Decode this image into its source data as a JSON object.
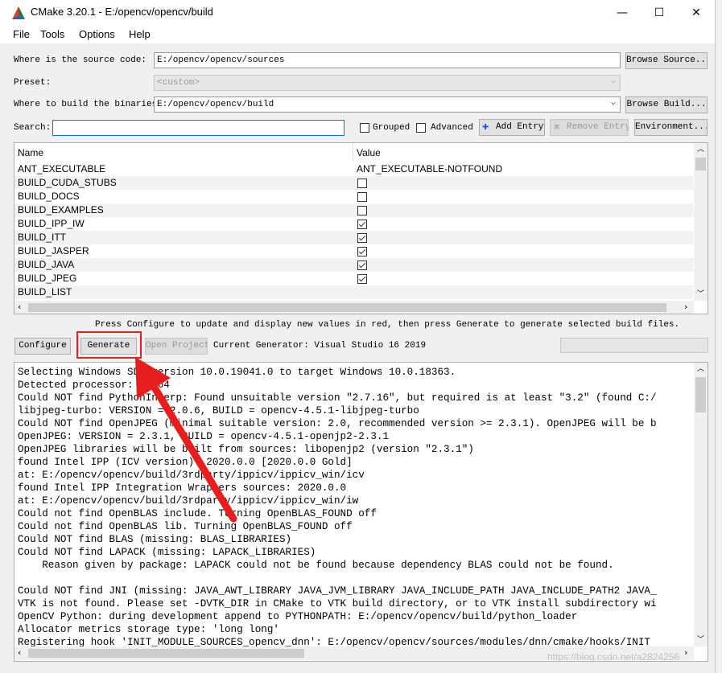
{
  "window": {
    "title": "CMake 3.20.1 - E:/opencv/opencv/build",
    "minimize": "—",
    "maximize": "☐",
    "close": "✕"
  },
  "menu": [
    "File",
    "Tools",
    "Options",
    "Help"
  ],
  "form": {
    "source_label": "Where is the source code:",
    "source_value": "E:/opencv/opencv/sources",
    "browse_source": "Browse Source...",
    "preset_label": "Preset:",
    "preset_value": "<custom>",
    "build_label": "Where to build the binaries:",
    "build_value": "E:/opencv/opencv/build",
    "browse_build": "Browse Build...",
    "search_label": "Search:",
    "search_value": "",
    "grouped": "Grouped",
    "advanced": "Advanced",
    "add_entry": "Add Entry",
    "remove_entry": "Remove Entry",
    "environment": "Environment..."
  },
  "table": {
    "headers": [
      "Name",
      "Value"
    ],
    "rows": [
      {
        "name": "ANT_EXECUTABLE",
        "value": "ANT_EXECUTABLE-NOTFOUND",
        "kind": "text"
      },
      {
        "name": "BUILD_CUDA_STUBS",
        "value": "",
        "kind": "check",
        "checked": false
      },
      {
        "name": "BUILD_DOCS",
        "value": "",
        "kind": "check",
        "checked": false
      },
      {
        "name": "BUILD_EXAMPLES",
        "value": "",
        "kind": "check",
        "checked": false
      },
      {
        "name": "BUILD_IPP_IW",
        "value": "",
        "kind": "check",
        "checked": true
      },
      {
        "name": "BUILD_ITT",
        "value": "",
        "kind": "check",
        "checked": true
      },
      {
        "name": "BUILD_JASPER",
        "value": "",
        "kind": "check",
        "checked": true
      },
      {
        "name": "BUILD_JAVA",
        "value": "",
        "kind": "check",
        "checked": true
      },
      {
        "name": "BUILD_JPEG",
        "value": "",
        "kind": "check",
        "checked": true
      },
      {
        "name": "BUILD_LIST",
        "value": "",
        "kind": "text"
      }
    ]
  },
  "hint": "Press Configure to update and display new values in red, then press Generate to generate selected build files.",
  "actions": {
    "configure": "Configure",
    "generate": "Generate",
    "open_project": "Open Project",
    "current_generator": "Current Generator: Visual Studio 16 2019"
  },
  "output_lines": [
    "Selecting Windows SDK version 10.0.19041.0 to target Windows 10.0.18363.",
    "Detected processor: AMD64",
    "Could NOT find PythonInterp: Found unsuitable version \"2.7.16\", but required is at least \"3.2\" (found C:/",
    "libjpeg-turbo: VERSION = 2.0.6, BUILD = opencv-4.5.1-libjpeg-turbo",
    "Could NOT find OpenJPEG (minimal suitable version: 2.0, recommended version >= 2.3.1). OpenJPEG will be b",
    "OpenJPEG: VERSION = 2.3.1, BUILD = opencv-4.5.1-openjp2-2.3.1",
    "OpenJPEG libraries will be built from sources: libopenjp2 (version \"2.3.1\")",
    "found Intel IPP (ICV version): 2020.0.0 [2020.0.0 Gold]",
    "at: E:/opencv/opencv/build/3rdparty/ippicv/ippicv_win/icv",
    "found Intel IPP Integration Wrappers sources: 2020.0.0",
    "at: E:/opencv/opencv/build/3rdparty/ippicv/ippicv_win/iw",
    "Could not find OpenBLAS include. Turning OpenBLAS_FOUND off",
    "Could not find OpenBLAS lib. Turning OpenBLAS_FOUND off",
    "Could NOT find BLAS (missing: BLAS_LIBRARIES)",
    "Could NOT find LAPACK (missing: LAPACK_LIBRARIES)",
    "    Reason given by package: LAPACK could not be found because dependency BLAS could not be found.",
    "",
    "Could NOT find JNI (missing: JAVA_AWT_LIBRARY JAVA_JVM_LIBRARY JAVA_INCLUDE_PATH JAVA_INCLUDE_PATH2 JAVA_",
    "VTK is not found. Please set -DVTK_DIR in CMake to VTK build directory, or to VTK install subdirectory wi",
    "OpenCV Python: during development append to PYTHONPATH: E:/opencv/opencv/build/python_loader",
    "Allocator metrics storage type: 'long long'",
    "Registering hook 'INIT_MODULE_SOURCES_opencv_dnn': E:/opencv/opencv/sources/modules/dnn/cmake/hooks/INIT"
  ],
  "watermark": "https://blog.csdn.net/a2824256",
  "colors": {
    "highlight": "#e81e1e",
    "input_border_focus": "#0078d7"
  }
}
